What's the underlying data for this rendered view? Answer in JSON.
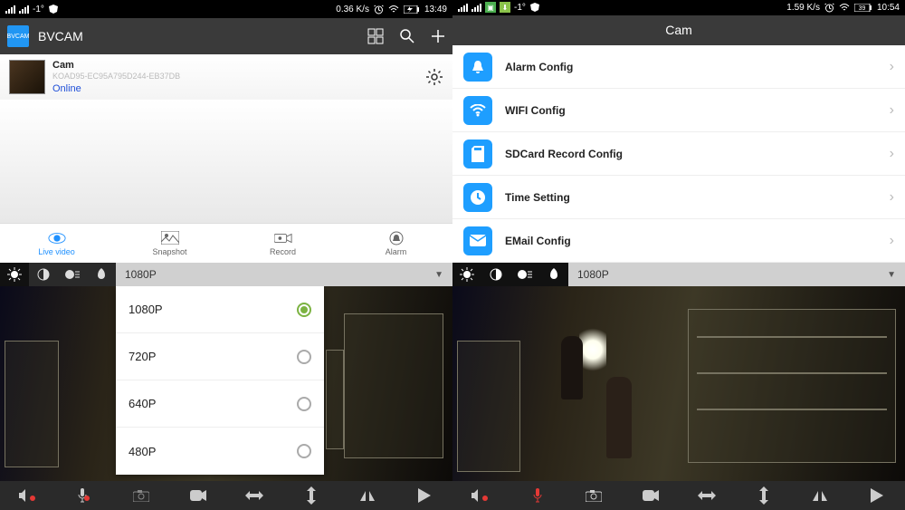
{
  "left": {
    "status": {
      "temp": "-1°",
      "speed": "0.36 K/s",
      "time": "13:49"
    },
    "app_title": "BVCAM",
    "device": {
      "name": "Cam",
      "uid": "KOAD95-EC95A795D244-EB37DB",
      "status": "Online"
    },
    "tabs": [
      {
        "label": "Live video",
        "active": true
      },
      {
        "label": "Snapshot",
        "active": false
      },
      {
        "label": "Record",
        "active": false
      },
      {
        "label": "Alarm",
        "active": false
      }
    ],
    "resolution_selected": "1080P",
    "resolution_options": [
      "1080P",
      "720P",
      "640P",
      "480P"
    ]
  },
  "right": {
    "status": {
      "temp": "-1°",
      "speed": "1.59 K/s",
      "time": "10:54",
      "battery": "39"
    },
    "page_title": "Cam",
    "settings": [
      {
        "label": "Alarm Config"
      },
      {
        "label": "WIFI Config"
      },
      {
        "label": "SDCard Record Config"
      },
      {
        "label": "Time Setting"
      },
      {
        "label": "EMail Config"
      }
    ],
    "resolution_selected": "1080P"
  }
}
